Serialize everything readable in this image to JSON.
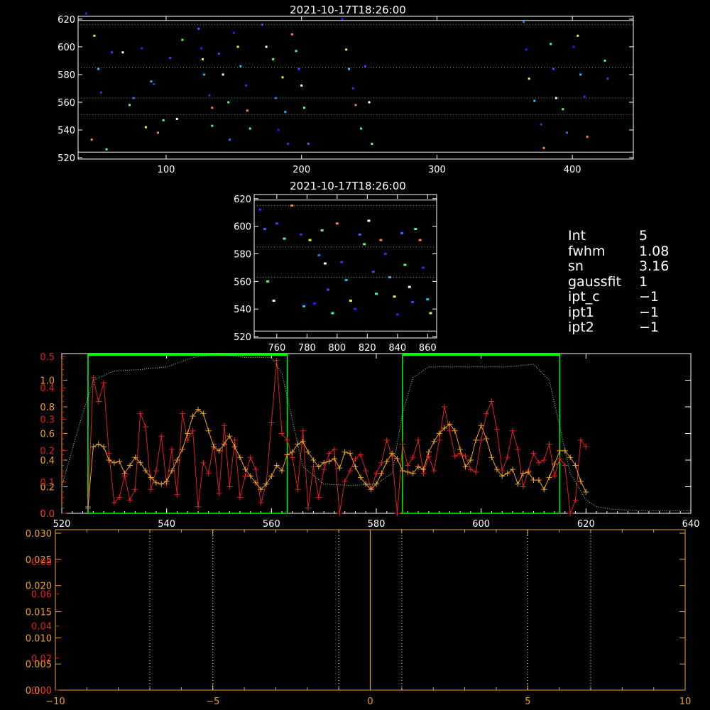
{
  "panel_top": {
    "title": "2021-10-17T18:26:00",
    "xticks": [
      "100",
      "200",
      "300",
      "400"
    ],
    "yticks": [
      "520",
      "540",
      "560",
      "580",
      "600",
      "620"
    ]
  },
  "panel_mid": {
    "title": "2021-10-17T18:26:00",
    "xticks": [
      "760",
      "780",
      "800",
      "820",
      "840",
      "860"
    ],
    "yticks": [
      "520",
      "540",
      "560",
      "580",
      "600",
      "620"
    ]
  },
  "info": {
    "rows": [
      {
        "key": "Int",
        "value": "5"
      },
      {
        "key": "fwhm",
        "value": "1.08"
      },
      {
        "key": "sn",
        "value": "3.16"
      },
      {
        "key": "gaussfit",
        "value": "1"
      },
      {
        "key": "ipt_c",
        "value": "−1"
      },
      {
        "key": "ipt1",
        "value": "−1"
      },
      {
        "key": "ipt2",
        "value": "−1"
      }
    ]
  },
  "panel_profile": {
    "xticks": [
      "520",
      "540",
      "560",
      "580",
      "600",
      "620",
      "640"
    ],
    "yticks_orange": [
      "0.0",
      "0.2",
      "0.4",
      "0.6",
      "0.8",
      "1.0"
    ],
    "yticks_red": [
      "0.0",
      "0.1",
      "0.2",
      "0.3",
      "0.4",
      "0.5"
    ]
  },
  "panel_bottom": {
    "xticks": [
      "−10",
      "−5",
      "0",
      "5",
      "10"
    ],
    "yticks_orange": [
      "0.000",
      "0.005",
      "0.010",
      "0.015",
      "0.020",
      "0.025",
      "0.030"
    ],
    "yticks_red": [
      "0.00",
      "0.02",
      "0.04",
      "0.06",
      "0.08"
    ]
  },
  "colors": {
    "axis": "#ffffff",
    "red": "#e02020",
    "orange": "#f0a020",
    "green": "#00ff00",
    "green_dotted": "#90ee90",
    "cream": "#ffffa0"
  },
  "chart_data": [
    {
      "type": "scatter",
      "title": "2021-10-17T18:26:00",
      "xlim": [
        35,
        445
      ],
      "ylim": [
        519,
        622
      ],
      "hlines_solid": [
        524,
        619
      ],
      "hlines_dotted_green": [
        616,
        585,
        563
      ],
      "hlines_dotted_red": [
        551
      ],
      "points": [
        [
          41,
          624
        ],
        [
          47,
          608
        ],
        [
          50,
          584
        ],
        [
          52,
          567
        ],
        [
          45,
          533
        ],
        [
          56,
          526
        ],
        [
          60,
          596
        ],
        [
          68,
          596
        ],
        [
          73,
          558
        ],
        [
          76,
          563
        ],
        [
          82,
          599
        ],
        [
          85,
          542
        ],
        [
          89,
          575
        ],
        [
          91,
          573
        ],
        [
          94,
          538
        ],
        [
          98,
          547
        ],
        [
          103,
          592
        ],
        [
          108,
          548
        ],
        [
          112,
          605
        ],
        [
          124,
          613
        ],
        [
          126,
          599
        ],
        [
          127,
          591
        ],
        [
          128,
          580
        ],
        [
          132,
          565
        ],
        [
          134,
          556
        ],
        [
          134,
          543
        ],
        [
          139,
          595
        ],
        [
          142,
          580
        ],
        [
          146,
          560
        ],
        [
          147,
          533
        ],
        [
          150,
          610
        ],
        [
          153,
          600
        ],
        [
          155,
          586
        ],
        [
          159,
          572
        ],
        [
          160,
          554
        ],
        [
          162,
          541
        ],
        [
          171,
          616
        ],
        [
          174,
          600
        ],
        [
          179,
          591
        ],
        [
          181,
          563
        ],
        [
          183,
          540
        ],
        [
          186,
          578
        ],
        [
          188,
          553
        ],
        [
          190,
          530
        ],
        [
          193,
          609
        ],
        [
          196,
          597
        ],
        [
          198,
          584
        ],
        [
          200,
          572
        ],
        [
          202,
          556
        ],
        [
          205,
          530
        ],
        [
          230,
          620
        ],
        [
          233,
          598
        ],
        [
          235,
          584
        ],
        [
          238,
          570
        ],
        [
          240,
          558
        ],
        [
          244,
          541
        ],
        [
          247,
          586
        ],
        [
          250,
          560
        ],
        [
          252,
          530
        ],
        [
          364,
          618
        ],
        [
          366,
          598
        ],
        [
          368,
          577
        ],
        [
          372,
          561
        ],
        [
          377,
          544
        ],
        [
          379,
          527
        ],
        [
          384,
          602
        ],
        [
          386,
          584
        ],
        [
          388,
          563
        ],
        [
          393,
          555
        ],
        [
          396,
          538
        ],
        [
          401,
          600
        ],
        [
          404,
          608
        ],
        [
          406,
          580
        ],
        [
          409,
          564
        ],
        [
          411,
          535
        ],
        [
          424,
          590
        ],
        [
          426,
          577
        ]
      ]
    },
    {
      "type": "scatter",
      "title": "2021-10-17T18:26:00",
      "xlim": [
        745,
        866
      ],
      "ylim": [
        519,
        623
      ],
      "hlines_solid": [
        524,
        619
      ],
      "hlines_dotted_green": [
        615,
        585,
        563
      ],
      "points": [
        [
          749,
          612
        ],
        [
          752,
          598
        ],
        [
          754,
          560
        ],
        [
          758,
          546
        ],
        [
          760,
          602
        ],
        [
          765,
          591
        ],
        [
          770,
          615
        ],
        [
          776,
          594
        ],
        [
          778,
          542
        ],
        [
          782,
          590
        ],
        [
          785,
          544
        ],
        [
          788,
          579
        ],
        [
          790,
          597
        ],
        [
          792,
          573
        ],
        [
          794,
          554
        ],
        [
          797,
          537
        ],
        [
          800,
          602
        ],
        [
          803,
          574
        ],
        [
          806,
          561
        ],
        [
          809,
          546
        ],
        [
          812,
          540
        ],
        [
          815,
          594
        ],
        [
          818,
          587
        ],
        [
          821,
          604
        ],
        [
          824,
          567
        ],
        [
          826,
          551
        ],
        [
          829,
          590
        ],
        [
          832,
          580
        ],
        [
          835,
          563
        ],
        [
          838,
          549
        ],
        [
          840,
          536
        ],
        [
          843,
          595
        ],
        [
          845,
          572
        ],
        [
          848,
          556
        ],
        [
          850,
          545
        ],
        [
          852,
          598
        ],
        [
          855,
          590
        ],
        [
          857,
          570
        ],
        [
          860,
          547
        ],
        [
          862,
          537
        ]
      ]
    },
    {
      "type": "line",
      "xlim": [
        520,
        640
      ],
      "ylim_left": [
        0,
        1.2
      ],
      "series": [
        {
          "color": "#e02020",
          "x": [
            525,
            526,
            527,
            528,
            529,
            530,
            531,
            532,
            533,
            534,
            535,
            536,
            537,
            538,
            539,
            540,
            541,
            542,
            543,
            544,
            545,
            546,
            547,
            548,
            549,
            550,
            551,
            552,
            553,
            554,
            555,
            556,
            557,
            558,
            559,
            560,
            561,
            562,
            563,
            564,
            565,
            566,
            567,
            568,
            569,
            570,
            571,
            572,
            573,
            574,
            575,
            576,
            577,
            578,
            579,
            580,
            581,
            582,
            583,
            584,
            585,
            586,
            587,
            588,
            589,
            590,
            591,
            592,
            593,
            594,
            595,
            596,
            597,
            598,
            599,
            600,
            601,
            602,
            603,
            604,
            605,
            606,
            607,
            608,
            609,
            610,
            611,
            612,
            613,
            614,
            615,
            616,
            617,
            618,
            619,
            620
          ],
          "y": [
            0.05,
            1.02,
            0.84,
            0.98,
            0.45,
            0.08,
            0.12,
            0.28,
            0.1,
            0.18,
            0.75,
            0.65,
            0.18,
            0.32,
            0.58,
            0.22,
            0.48,
            0.14,
            0.75,
            0.55,
            0.62,
            0.05,
            0.38,
            0.3,
            0.52,
            0.15,
            0.66,
            0.2,
            0.55,
            0.12,
            0.28,
            0.42,
            0.33,
            0.08,
            0.22,
            0.68,
            1.15,
            0.6,
            0.55,
            0.42,
            0.18,
            0.62,
            0.04,
            0.35,
            0.12,
            0.33,
            0.45,
            0.48,
            0.0,
            0.24,
            0.32,
            0.41,
            0.44,
            0.32,
            0.18,
            0.3,
            0.38,
            0.55,
            0.43,
            0.0,
            0.52,
            0.36,
            0.42,
            0.55,
            0.3,
            0.43,
            0.32,
            0.55,
            0.8,
            0.62,
            0.43,
            0.45,
            0.43,
            0.33,
            0.31,
            0.55,
            0.75,
            0.84,
            0.63,
            0.32,
            0.42,
            0.62,
            0.48,
            0.2,
            0.32,
            0.45,
            0.38,
            0.4,
            0.52,
            0.28,
            0.41,
            0.36,
            0.0,
            0.1,
            0.55,
            0.5
          ]
        },
        {
          "color": "#f0a020",
          "x": [
            525,
            526,
            527,
            528,
            529,
            530,
            531,
            532,
            533,
            534,
            535,
            536,
            537,
            538,
            539,
            540,
            541,
            542,
            543,
            544,
            545,
            546,
            547,
            548,
            549,
            550,
            551,
            552,
            553,
            554,
            555,
            556,
            557,
            558,
            559,
            560,
            561,
            562,
            563,
            564,
            565,
            566,
            567,
            568,
            569,
            570,
            571,
            572,
            573,
            574,
            575,
            576,
            577,
            578,
            579,
            580,
            581,
            582,
            583,
            584,
            585,
            586,
            587,
            588,
            589,
            590,
            591,
            592,
            593,
            594,
            595,
            596,
            597,
            598,
            599,
            600,
            601,
            602,
            603,
            604,
            605,
            606,
            607,
            608,
            609,
            610,
            611,
            612,
            613,
            614,
            615,
            616,
            617,
            618,
            619,
            620
          ],
          "y": [
            0.04,
            0.5,
            0.52,
            0.5,
            0.4,
            0.38,
            0.39,
            0.3,
            0.36,
            0.42,
            0.38,
            0.32,
            0.27,
            0.23,
            0.22,
            0.24,
            0.32,
            0.4,
            0.48,
            0.6,
            0.73,
            0.78,
            0.75,
            0.62,
            0.5,
            0.47,
            0.52,
            0.58,
            0.5,
            0.42,
            0.33,
            0.28,
            0.23,
            0.18,
            0.22,
            0.28,
            0.36,
            0.32,
            0.44,
            0.46,
            0.52,
            0.54,
            0.46,
            0.4,
            0.35,
            0.38,
            0.39,
            0.41,
            0.34,
            0.46,
            0.45,
            0.35,
            0.27,
            0.22,
            0.18,
            0.22,
            0.3,
            0.39,
            0.45,
            0.41,
            0.32,
            0.31,
            0.3,
            0.35,
            0.33,
            0.46,
            0.54,
            0.6,
            0.64,
            0.67,
            0.62,
            0.48,
            0.35,
            0.4,
            0.55,
            0.66,
            0.56,
            0.42,
            0.33,
            0.28,
            0.3,
            0.33,
            0.22,
            0.3,
            0.31,
            0.25,
            0.25,
            0.18,
            0.27,
            0.37,
            0.47,
            0.47,
            0.42,
            0.36,
            0.24,
            0.16
          ]
        },
        {
          "color": "#90ee90",
          "dash": "dotted",
          "x": [
            520,
            523,
            526,
            530,
            535,
            540,
            545,
            550,
            555,
            560,
            562,
            564,
            566,
            570,
            575,
            580,
            583,
            585,
            587,
            590,
            595,
            600,
            605,
            610,
            613,
            615,
            617,
            620,
            622,
            625,
            630,
            635,
            640
          ],
          "y": [
            0.2,
            0.62,
            1.0,
            1.07,
            1.08,
            1.1,
            1.17,
            1.2,
            1.17,
            1.17,
            1.05,
            0.7,
            0.35,
            0.22,
            0.21,
            0.22,
            0.3,
            0.75,
            1.02,
            1.1,
            1.1,
            1.1,
            1.1,
            1.12,
            1.0,
            0.65,
            0.3,
            0.1,
            0.05,
            0.03,
            0.02,
            0.02,
            0.02
          ]
        }
      ],
      "green_boxes": [
        [
          525,
          563
        ],
        [
          585,
          615
        ]
      ]
    },
    {
      "type": "line",
      "xlim": [
        -10,
        10
      ],
      "ylim_left": [
        0,
        0.03
      ],
      "vline_solid": [
        0
      ],
      "vlines_dotted": [
        -7,
        -5,
        -1,
        1,
        5,
        7
      ]
    }
  ]
}
